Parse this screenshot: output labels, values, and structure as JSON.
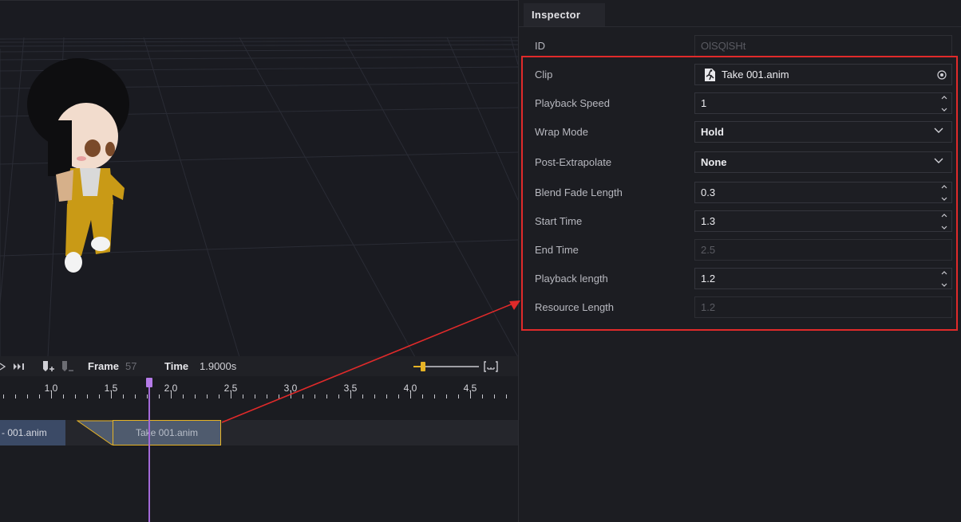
{
  "timeline": {
    "frame_label": "Frame",
    "frame_value": "57",
    "time_label": "Time",
    "time_value": "1.9000s",
    "ruler_ticks": [
      "1.0",
      "1.5",
      "2.0",
      "2.5",
      "3.0",
      "3.5",
      "4.0",
      "4.5"
    ],
    "clip_left_label": "- 001.anim",
    "clip_main_label": "Take 001.anim",
    "zoom_level": 0.1
  },
  "inspector": {
    "tab_label": "Inspector",
    "id_label": "ID",
    "id_value": "OlSQlSHt",
    "props": {
      "clip": {
        "label": "Clip",
        "value": "Take 001.anim"
      },
      "playback_speed": {
        "label": "Playback Speed",
        "value": "1"
      },
      "wrap_mode": {
        "label": "Wrap Mode",
        "value": "Hold"
      },
      "post_extrapolate": {
        "label": "Post-Extrapolate",
        "value": "None"
      },
      "blend_fade_length": {
        "label": "Blend Fade Length",
        "value": "0.3"
      },
      "start_time": {
        "label": "Start Time",
        "value": "1.3"
      },
      "end_time": {
        "label": "End Time",
        "value": "2.5"
      },
      "playback_length": {
        "label": "Playback length",
        "value": "1.2"
      },
      "resource_length": {
        "label": "Resource Length",
        "value": "1.2"
      }
    }
  },
  "colors": {
    "highlight": "#e02a2a",
    "accent_orange": "#e6b325",
    "playhead": "#a46ad9"
  }
}
